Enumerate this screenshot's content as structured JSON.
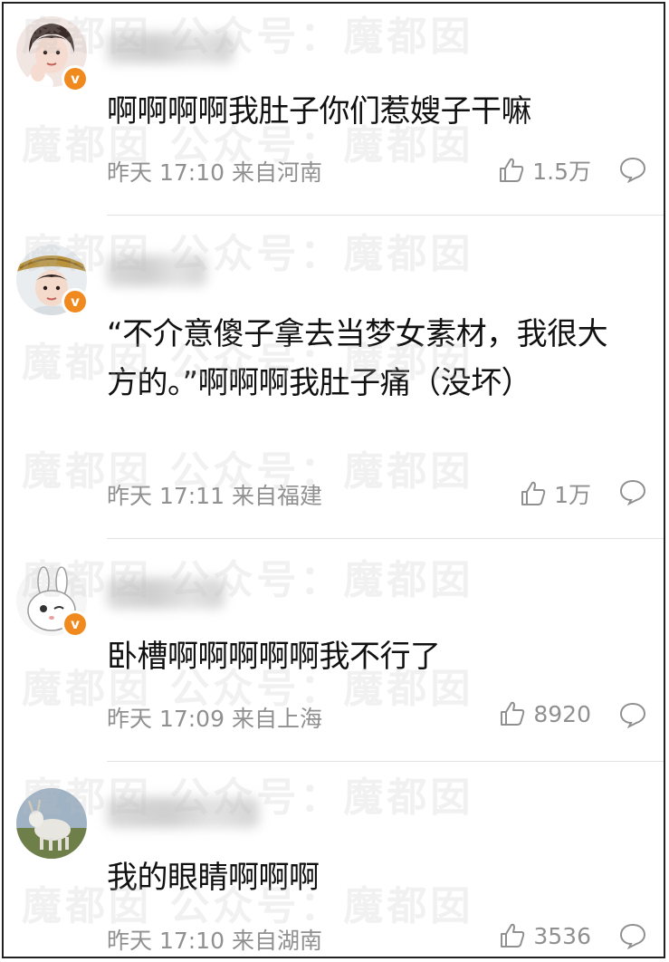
{
  "comments": [
    {
      "text": "啊啊啊啊我肚子你们惹嫂子干嘛",
      "time": "昨天 17:10",
      "location": "来自河南",
      "likes": "1.5万",
      "verified_badge": "v",
      "avatar": "boy-with-hand-on-face"
    },
    {
      "text": "“不介意傻子拿去当梦女素材，我很大方的。”啊啊啊我肚子痛（没坏）",
      "time": "昨天 17:11",
      "location": "来自福建",
      "likes": "1万",
      "verified_badge": "v",
      "avatar": "boy-with-straw-hat"
    },
    {
      "text": "卧槽啊啊啊啊啊我不行了",
      "time": "昨天 17:09",
      "location": "来自上海",
      "likes": "8920",
      "verified_badge": "v",
      "avatar": "white-rabbit-cartoon"
    },
    {
      "text": "我的眼睛啊啊啊",
      "time": "昨天 17:10",
      "location": "来自湖南",
      "likes": "3536",
      "avatar": "white-goat-on-grass"
    }
  ],
  "watermark": "魔都囡  公众号：魔都囡",
  "colors": {
    "badge": "#f08a1e",
    "meta_text": "#909090",
    "divider": "#e2e2e2",
    "body_text": "#111111"
  }
}
